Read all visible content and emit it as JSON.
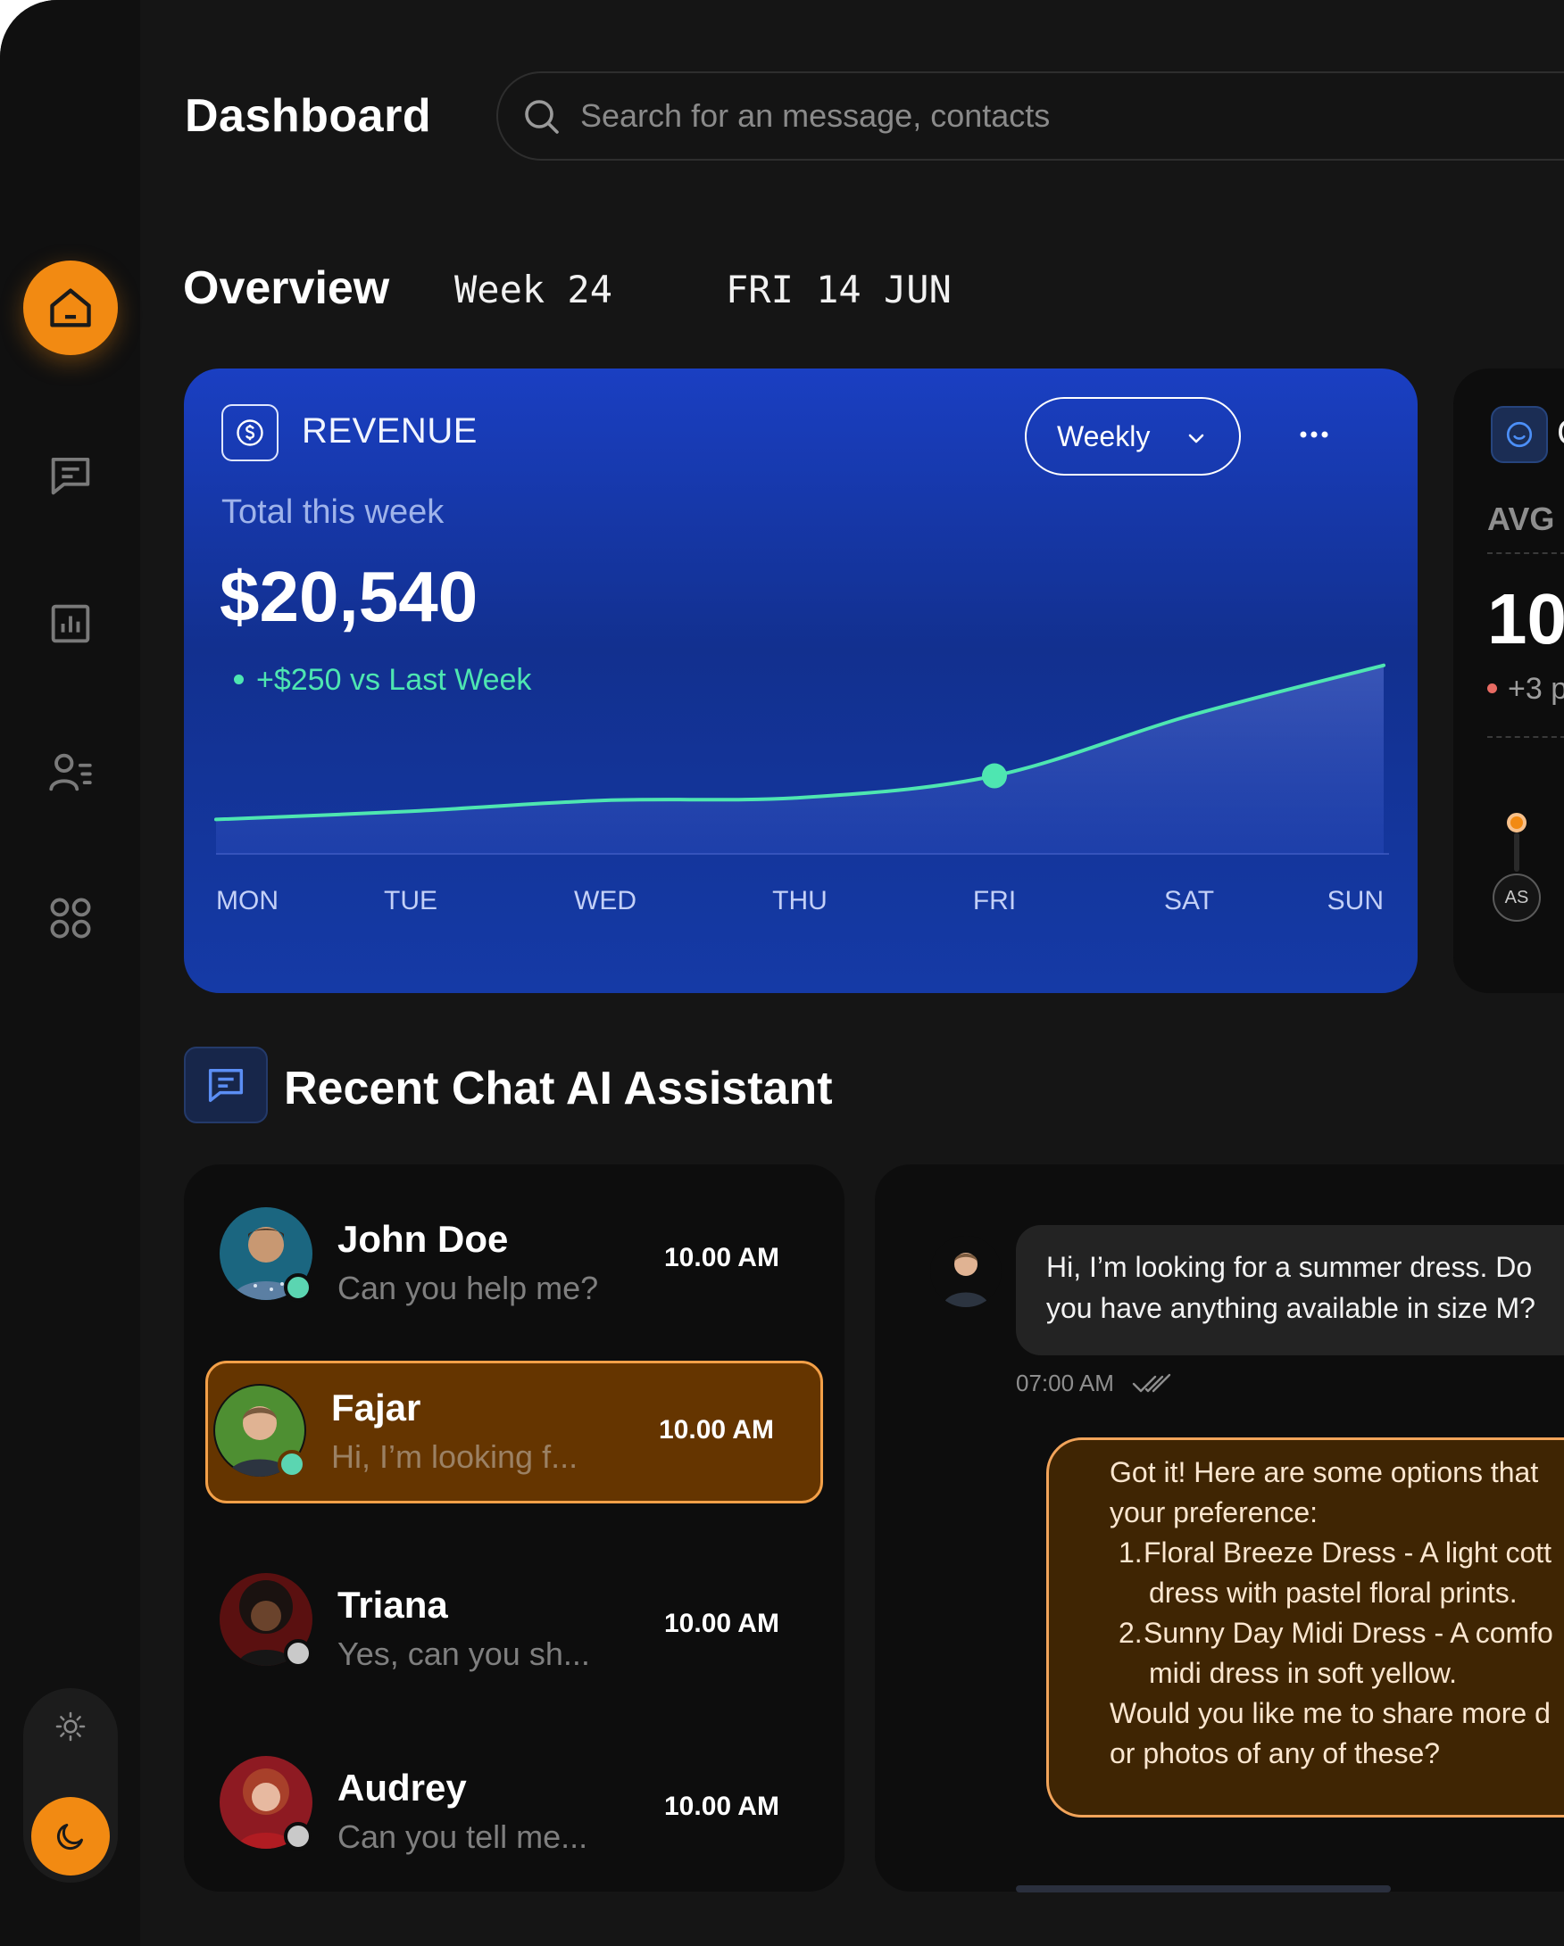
{
  "header": {
    "title": "Dashboard",
    "search_placeholder": "Search for an message, contacts"
  },
  "sidebar": {
    "items": [
      {
        "name": "home",
        "icon": "home-icon",
        "active": true
      },
      {
        "name": "messages",
        "icon": "message-icon",
        "active": false
      },
      {
        "name": "analytics",
        "icon": "bar-chart-icon",
        "active": false
      },
      {
        "name": "contacts",
        "icon": "contacts-icon",
        "active": false
      },
      {
        "name": "apps",
        "icon": "command-icon",
        "active": false
      }
    ],
    "theme": {
      "light_icon": "sun-icon",
      "dark_icon": "moon-icon",
      "selected": "dark"
    }
  },
  "overview": {
    "title": "Overview",
    "week": "Week 24",
    "date": "FRI 14 JUN"
  },
  "revenue": {
    "title": "REVENUE",
    "period_select": "Weekly",
    "total_label": "Total this week",
    "total_value": "$20,540",
    "trend": "+$250 vs Last Week"
  },
  "chart_data": {
    "type": "area",
    "categories": [
      "MON",
      "TUE",
      "WED",
      "THU",
      "FRI",
      "SAT",
      "SUN"
    ],
    "values": [
      2,
      2.6,
      3.4,
      3.6,
      5.2,
      9.6,
      13.3
    ],
    "highlight_index": 4,
    "grid": false,
    "colors": {
      "line": "#4ee6b1",
      "fill": "#3b5bd1"
    }
  },
  "csat": {
    "title": "C",
    "avg_label": "AVG",
    "value": "10",
    "value_suffix": "/",
    "change": "+3 p",
    "badge": "AS"
  },
  "recent_chat": {
    "title": "Recent Chat AI Assistant",
    "items": [
      {
        "name": "John Doe",
        "message": "Can you help me?",
        "time": "10.00 AM",
        "status": "online",
        "selected": false
      },
      {
        "name": "Fajar",
        "message": "Hi, I’m looking f...",
        "time": "10.00 AM",
        "status": "online",
        "selected": true
      },
      {
        "name": "Triana",
        "message": "Yes, can you sh...",
        "time": "10.00 AM",
        "status": "offline",
        "selected": false
      },
      {
        "name": "Audrey",
        "message": "Can you tell me...",
        "time": "10.00 AM",
        "status": "offline",
        "selected": false
      }
    ]
  },
  "conversation": {
    "user_message_line1": "Hi, I’m looking for a summer dress. Do",
    "user_message_line2": "you have anything available in size M?",
    "user_time": "07:00 AM",
    "bot_line1": "Got it! Here are some options that",
    "bot_line2": "your preference:",
    "bot_item1_num": "1.",
    "bot_item1_a": "Floral Breeze Dress - A light cott",
    "bot_item1_b": "dress with pastel floral prints.",
    "bot_item2_num": "2.",
    "bot_item2_a": "Sunny Day Midi Dress - A comfo",
    "bot_item2_b": "midi dress in soft yellow.",
    "bot_line3": "Would you like me to share more d",
    "bot_line4": "or photos of any of these?"
  },
  "colors": {
    "accent": "#f28a12",
    "revenue_card": "#1a3fc2",
    "online": "#5bd5b1",
    "trend": "#4ee6b1"
  }
}
